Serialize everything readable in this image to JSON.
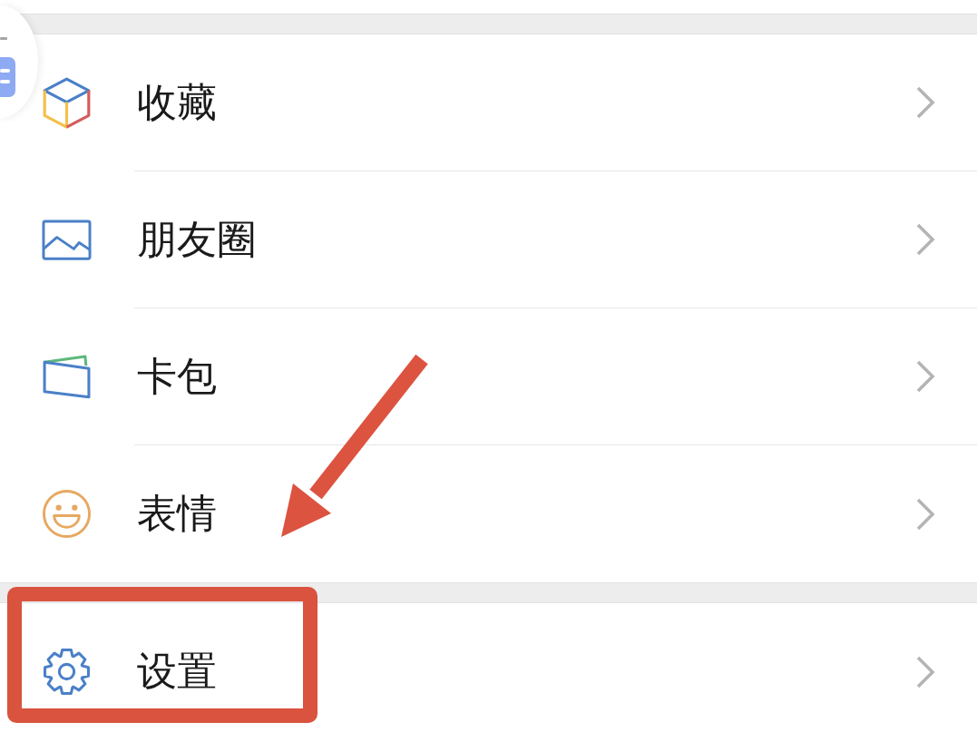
{
  "sections": [
    {
      "items": [
        {
          "label": "收藏",
          "highlighted": false
        },
        {
          "label": "朋友圈",
          "highlighted": false
        },
        {
          "label": "卡包",
          "highlighted": false
        },
        {
          "label": "表情",
          "highlighted": false
        }
      ]
    },
    {
      "items": [
        {
          "label": "设置",
          "highlighted": true
        }
      ]
    }
  ]
}
